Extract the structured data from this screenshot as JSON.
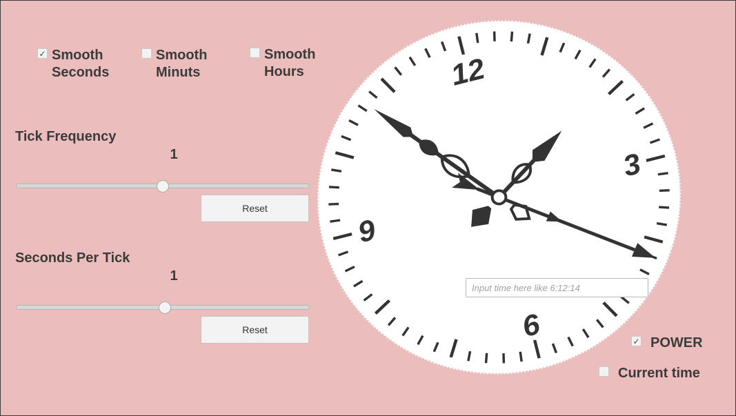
{
  "options": {
    "smooth_seconds": {
      "label": "Smooth\nSeconds",
      "checked": true
    },
    "smooth_minutes": {
      "label": "Smooth\nMinuts",
      "checked": false
    },
    "smooth_hours": {
      "label": "Smooth\nHours",
      "checked": false
    }
  },
  "tick_frequency": {
    "title": "Tick Frequency",
    "value": "1",
    "slider_fraction": 0.5,
    "reset_label": "Reset"
  },
  "seconds_per_tick": {
    "title": "Seconds Per Tick",
    "value": "1",
    "slider_fraction": 0.506,
    "reset_label": "Reset"
  },
  "clock": {
    "numerals": {
      "n12": "12",
      "n3": "3",
      "n6": "6",
      "n9": "9"
    },
    "time_shown": "1:53:21"
  },
  "time_input": {
    "placeholder": "Input time here like 6:12:14",
    "value": ""
  },
  "power": {
    "label": "POWER",
    "checked": true
  },
  "current_time": {
    "label": "Current time",
    "checked": false
  },
  "icons": {
    "checkmark": "✓"
  },
  "colors": {
    "background": "#ecbdbd",
    "dial": "#ffffff",
    "hands": "#333333"
  }
}
